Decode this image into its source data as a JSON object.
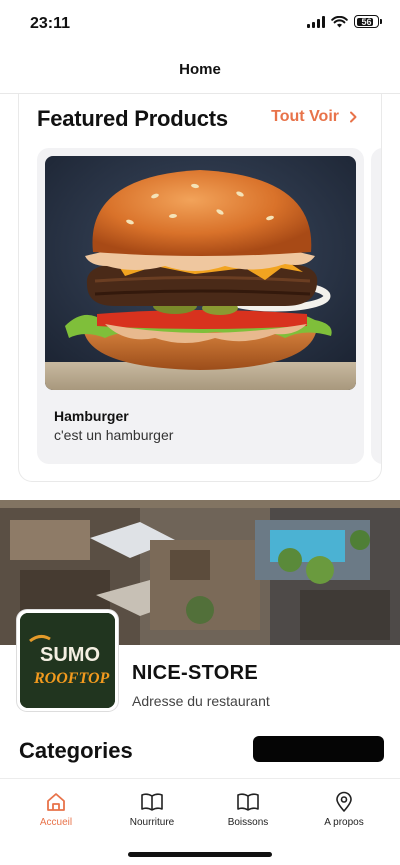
{
  "status_bar": {
    "time": "23:11",
    "battery": "56"
  },
  "header": {
    "title": "Home"
  },
  "featured": {
    "title": "Featured Products",
    "see_all_label": "Tout Voir",
    "products": [
      {
        "name": "Hamburger",
        "description": "c'est un hamburger"
      }
    ]
  },
  "store": {
    "name": "NICE-STORE",
    "address": "Adresse du restaurant",
    "logo_text_top": "SUMO",
    "logo_text_bottom": "ROOFTOP"
  },
  "categories": {
    "title": "Categories"
  },
  "tabs": [
    {
      "label": "Accueil",
      "icon": "home-icon",
      "active": true
    },
    {
      "label": "Nourriture",
      "icon": "book-icon",
      "active": false
    },
    {
      "label": "Boissons",
      "icon": "book-icon",
      "active": false
    },
    {
      "label": "A propos",
      "icon": "location-pin-icon",
      "active": false
    }
  ],
  "colors": {
    "accent": "#e8734a",
    "text": "#111111",
    "card_bg": "#f2f2f4"
  }
}
